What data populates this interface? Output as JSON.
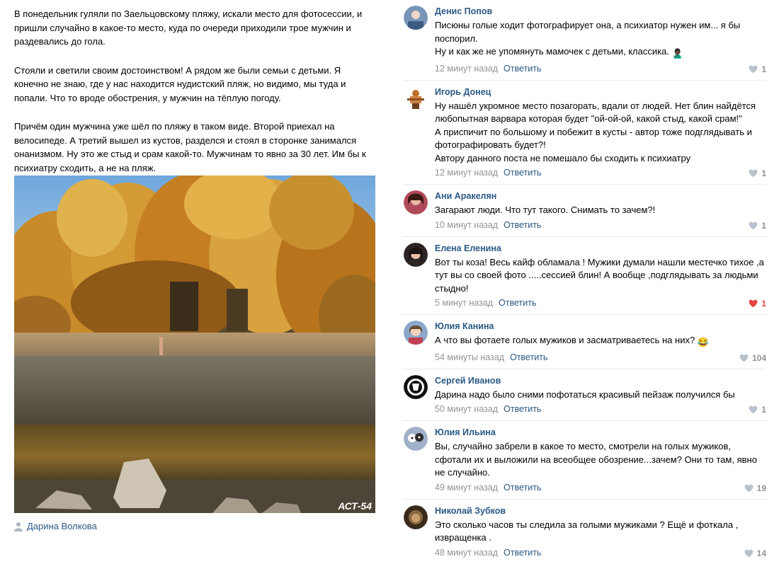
{
  "post": {
    "paragraphs": [
      "В понедельник гуляли по Заельцовскому пляжу, искали место для фотосессии, и пришли случайно в какое-то место, куда по очереди приходили трое мужчин и раздевались до гола.",
      "Стояли и светили своим достоинством! А рядом же были семьи с детьми. Я конечно не знаю, где у нас находится нудистский пляж, но видимо, мы туда и попали. Что то вроде обострения, у мужчин на тёплую погоду.",
      "Причём один мужчина уже шёл по пляжу в таком виде. Второй приехал на велосипеде. А третий вышел из кустов, разделся и стоял в сторонке занимался онанизмом. Ну это же стыд и срам какой-то. Мужчинам то явно за 30 лет. Им бы к психиатру сходить, а не на пляж."
    ],
    "watermark": "АСТ-54",
    "author": "Дарина Волкова"
  },
  "comments": [
    {
      "name": "Денис Попов",
      "lines": [
        "Писюны голые ходит фотографирует она, а психиатор нужен им... я бы поспорил.",
        "Ну и как же не упомянуть мамочек с детьми, классика."
      ],
      "emoji": "🙎🏿‍♂️",
      "time": "12 минут назад",
      "reply": "Ответить",
      "likes": "1",
      "liked": false
    },
    {
      "name": "Игорь Донец",
      "lines": [
        "Ну нашёл укромное место позагорать, вдали от людей. Нет блин найдётся любопытная варвара которая будет \"ой-ой-ой, какой стыд, какой срам!\"",
        "А приспичит по большому и побежит в кусты - автор тоже подглядывать и фотографировать будет?!",
        "Автору данного поста не помешало бы сходить к психиатру"
      ],
      "time": "12 минут назад",
      "reply": "Ответить",
      "likes": "1",
      "liked": false
    },
    {
      "name": "Ани Аракелян",
      "lines": [
        "Загарают люди. Что тут такого. Снимать то зачем?!"
      ],
      "time": "10 минут назад",
      "reply": "Ответить",
      "likes": "1",
      "liked": false
    },
    {
      "name": "Елена Еленина",
      "lines": [
        "Вот ты коза! Весь кайф обламала ! Мужики думали нашли местечко тихое ,а тут вы со своей фото .....сессией блин! А вообще ,подглядывать за людьми стыдно!"
      ],
      "time": "5 минут назад",
      "reply": "Ответить",
      "likes": "1",
      "liked": true
    },
    {
      "name": "Юлия Канина",
      "lines": [
        "А что вы фотаете голых мужиков и засматриваетесь на них?"
      ],
      "emoji": "😂",
      "time": "54 минуты назад",
      "reply": "Ответить",
      "likes": "104",
      "liked": false
    },
    {
      "name": "Сергей Иванов",
      "lines": [
        "Дарина надо было сними пофотаться красивый пейзаж получился бы"
      ],
      "time": "50 минут назад",
      "reply": "Ответить",
      "likes": "1",
      "liked": false
    },
    {
      "name": "Юлия Ильина",
      "lines": [
        "Вы, случайно забрели в какое то место, смотрели на голых мужиков, сфотали их и выложили на всеобщее обозрение...зачем? Они то там, явно не случайно."
      ],
      "time": "49 минут назад",
      "reply": "Ответить",
      "likes": "19",
      "liked": false
    },
    {
      "name": "Николай Зубков",
      "lines": [
        "Это сколько часов ты следила за голыми мужиками ? Ещё и фоткала , извращенка ."
      ],
      "time": "48 минут назад",
      "reply": "Ответить",
      "likes": "14",
      "liked": false
    }
  ],
  "colors": {
    "link": "#2a5885",
    "meta": "#939393",
    "liked": "#e64646"
  }
}
